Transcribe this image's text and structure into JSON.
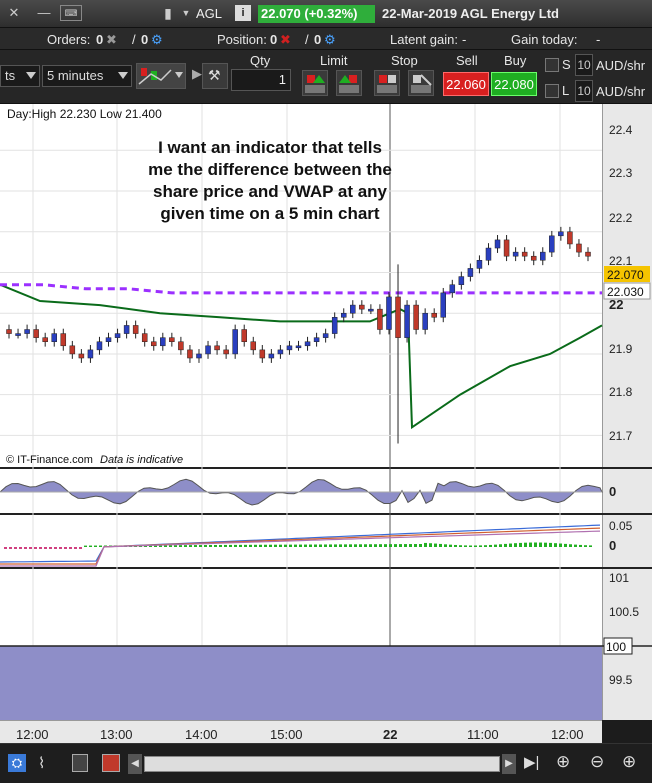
{
  "titlebar": {
    "symbol": "AGL",
    "info_icon": "i",
    "price_change": "22.070 (+0.32%)",
    "date_company": "22-Mar-2019 AGL Energy Ltd"
  },
  "orders_bar": {
    "orders_label": "Orders:",
    "orders_count": "0",
    "orders_sep": "/",
    "orders_pending": "0",
    "position_label": "Position:",
    "position_count": "0",
    "position_sep": "/",
    "position_pending": "0",
    "latent_label": "Latent gain:",
    "latent_value": "-",
    "today_label": "Gain today:",
    "today_value": "-"
  },
  "toolbar": {
    "chart_type": "ts",
    "interval": "5 minutes",
    "qty_label": "Qty",
    "qty_value": "1",
    "limit_label": "Limit",
    "stop_label": "Stop",
    "sell_label": "Sell",
    "buy_label": "Buy",
    "sell_price": "22.060",
    "buy_price": "22.080",
    "s_label": "S",
    "l_label": "L",
    "s_box": "10",
    "l_box": "10",
    "unit_top": "AUD/shr",
    "unit_bottom": "AUD/shr"
  },
  "chart_header": {
    "day_range": "Day:High 22.230 Low 21.400"
  },
  "annotation": {
    "line1": "I want an indicator that tells",
    "line2": "me the difference between the",
    "line3": "share price and VWAP at any",
    "line4": "given time on a 5 min chart"
  },
  "credit": {
    "source": "© IT-Finance.com",
    "note": "Data is indicative"
  },
  "price_axis": {
    "ticks": [
      "22.4",
      "22.3",
      "22.2",
      "22.1",
      "22",
      "21.9",
      "21.8",
      "21.7"
    ],
    "tag_last": "22.070",
    "tag_vwap": "22.030",
    "osc1_tick": "0",
    "osc2_ticks": [
      "0.05",
      "0"
    ],
    "osc3_ticks": [
      "101",
      "100.5",
      "100",
      "99.5"
    ]
  },
  "time_axis": [
    "12:00",
    "13:00",
    "14:00",
    "15:00",
    "22",
    "11:00",
    "12:00"
  ],
  "colors": {
    "up_candle": "#2a3fbf",
    "down_candle": "#c0392b",
    "vwap": "#9b30ff",
    "ma": "#0a6b1a",
    "osc_fill": "#8e8ec8",
    "sell": "#d82020",
    "buy": "#1fae22"
  },
  "chart_data": {
    "type": "candlestick",
    "title": "",
    "ylim": [
      21.62,
      22.44
    ],
    "x": [
      "12:00",
      "13:00",
      "14:00",
      "15:00",
      "22",
      "11:00",
      "12:00"
    ],
    "closes": [
      21.95,
      21.95,
      21.96,
      21.94,
      21.93,
      21.95,
      21.92,
      21.9,
      21.89,
      21.91,
      21.93,
      21.94,
      21.95,
      21.97,
      21.95,
      21.93,
      21.92,
      21.94,
      21.93,
      21.91,
      21.89,
      21.9,
      21.92,
      21.91,
      21.9,
      21.96,
      21.93,
      21.91,
      21.89,
      21.9,
      21.91,
      21.92,
      21.92,
      21.93,
      21.94,
      21.95,
      21.99,
      22.0,
      22.02,
      22.01,
      22.01,
      21.96,
      22.04,
      21.94,
      22.02,
      21.96,
      22.0,
      21.99,
      22.05,
      22.07,
      22.09,
      22.11,
      22.13,
      22.16,
      22.18,
      22.14,
      22.15,
      22.14,
      22.13,
      22.15,
      22.19,
      22.2,
      22.17,
      22.15,
      22.14
    ],
    "series": [
      {
        "name": "",
        "values": [
          22.07,
          22.07,
          22.06,
          22.06,
          22.05,
          22.05,
          22.05,
          22.05,
          22.05,
          22.05,
          22.05,
          22.05,
          22.05,
          22.05,
          22.05
        ]
      },
      {
        "name": "",
        "values": [
          22.07,
          22.03,
          22.02,
          22.0,
          21.99,
          21.98,
          21.98,
          21.98,
          22.01,
          22.0,
          21.72,
          21.8,
          21.87,
          21.9,
          21.94,
          21.97
        ]
      }
    ]
  }
}
